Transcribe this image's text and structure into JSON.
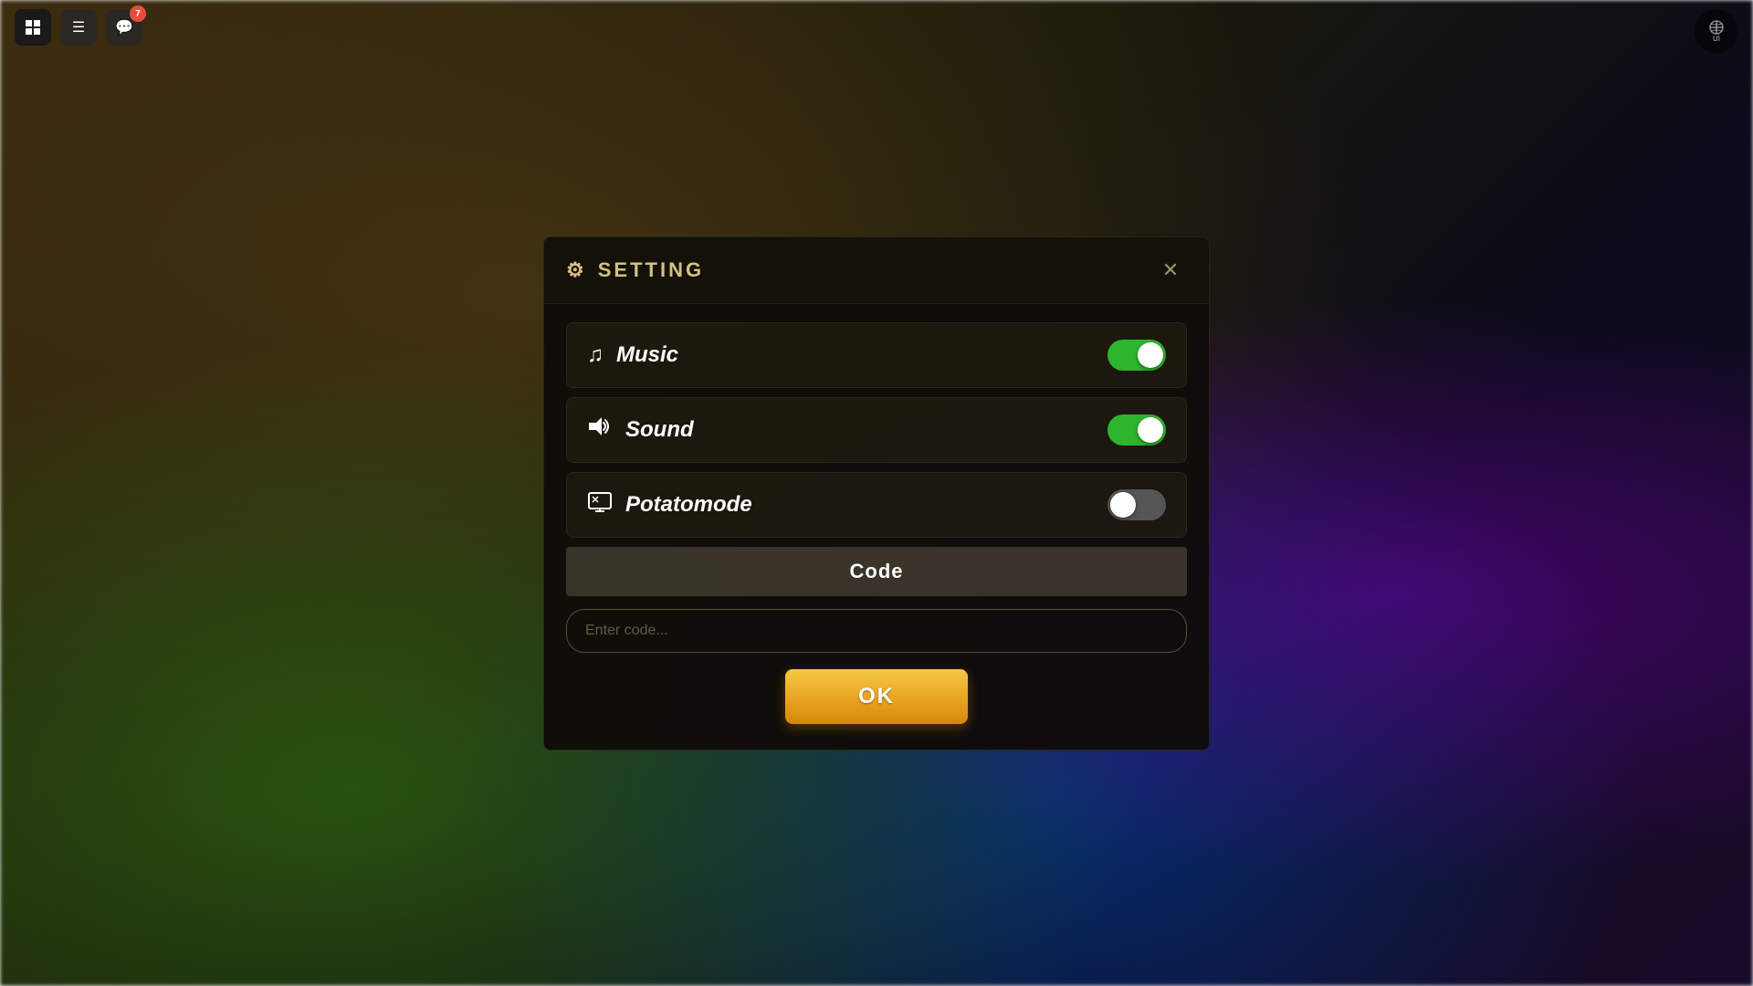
{
  "topbar": {
    "roblox_logo": "■",
    "menu_icon": "☰",
    "notification_icon": "💬",
    "notification_badge": "7",
    "ui_label": "UI"
  },
  "dialog": {
    "title": "SETTING",
    "gear_icon": "⚙",
    "close_icon": "✕",
    "rows": [
      {
        "id": "music",
        "icon": "♫",
        "label": "Music",
        "toggle_state": "on"
      },
      {
        "id": "sound",
        "icon": "🔊",
        "label": "Sound",
        "toggle_state": "on"
      },
      {
        "id": "potatomode",
        "icon": "🖥",
        "label": "Potatomode",
        "toggle_state": "off"
      }
    ],
    "code_section": {
      "label": "Code",
      "input_placeholder": "Enter code...",
      "ok_button": "OK"
    }
  }
}
